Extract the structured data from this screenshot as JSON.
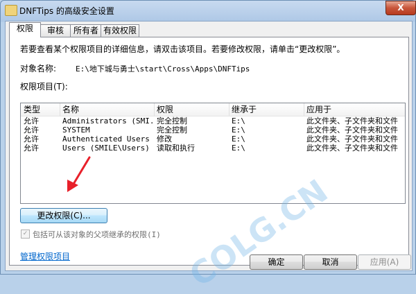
{
  "window": {
    "title": "DNFTips 的高级安全设置",
    "close_glyph": "X"
  },
  "tabs": [
    {
      "label": "权限",
      "active": true
    },
    {
      "label": "审核"
    },
    {
      "label": "所有者"
    },
    {
      "label": "有效权限"
    }
  ],
  "intro_text": "若要查看某个权限项目的详细信息，请双击该项目。若要修改权限，请单击“更改权限”。",
  "object": {
    "label": "对象名称:",
    "value": "E:\\地下城与勇士\\start\\Cross\\Apps\\DNFTips"
  },
  "list_label": "权限项目(T):",
  "columns": [
    "类型",
    "名称",
    "权限",
    "继承于",
    "应用于"
  ],
  "entries": [
    {
      "type": "允许",
      "name": "Administrators (SMI...",
      "permission": "完全控制",
      "inherited_from": "E:\\",
      "applies_to": "此文件夹、子文件夹和文件"
    },
    {
      "type": "允许",
      "name": "SYSTEM",
      "permission": "完全控制",
      "inherited_from": "E:\\",
      "applies_to": "此文件夹、子文件夹和文件"
    },
    {
      "type": "允许",
      "name": "Authenticated Users",
      "permission": "修改",
      "inherited_from": "E:\\",
      "applies_to": "此文件夹、子文件夹和文件"
    },
    {
      "type": "允许",
      "name": "Users (SMILE\\Users)",
      "permission": "读取和执行",
      "inherited_from": "E:\\",
      "applies_to": "此文件夹、子文件夹和文件"
    }
  ],
  "change_permissions_button": "更改权限(C)...",
  "inherit_checkbox": {
    "label": "包括可从该对象的父项继承的权限(I)",
    "checked": true,
    "check_glyph": "✓"
  },
  "manage_link": "管理权限项目",
  "buttons": {
    "ok": "确定",
    "cancel": "取消",
    "apply": "应用(A)"
  },
  "watermark": "COLG.CN",
  "colors": {
    "accent_red": "#e8202a",
    "link": "#0066cc"
  }
}
